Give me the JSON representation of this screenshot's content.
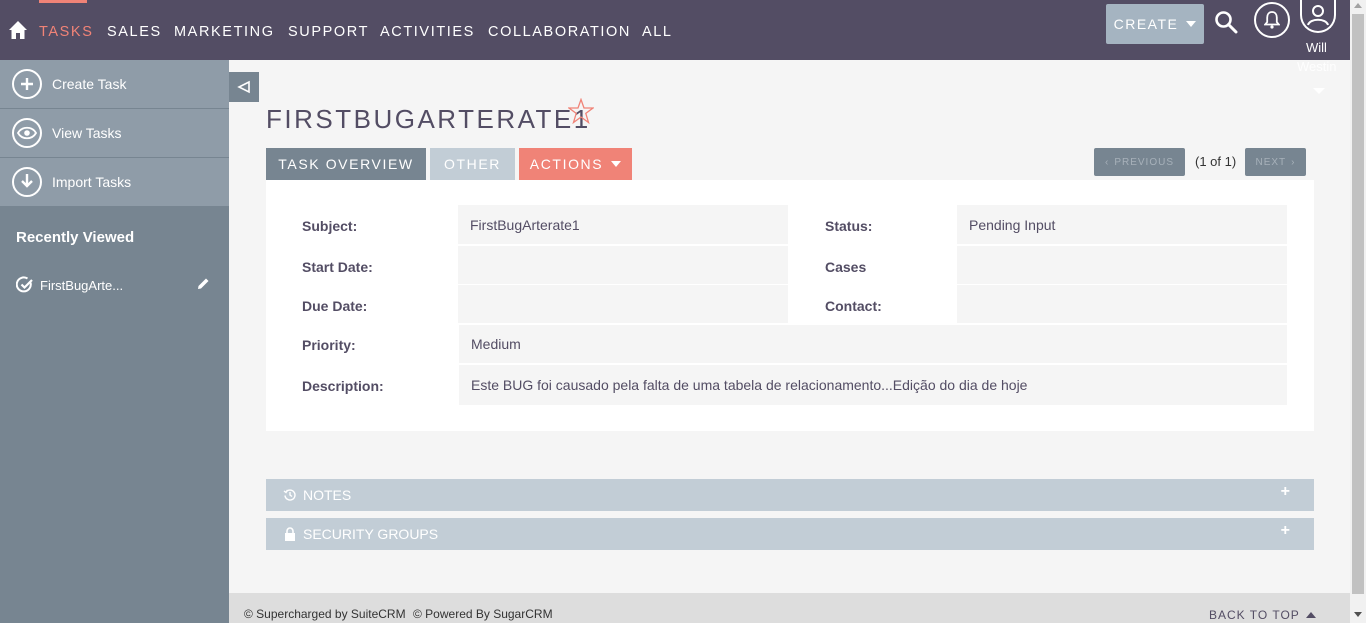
{
  "nav": {
    "items": [
      "TASKS",
      "SALES",
      "MARKETING",
      "SUPPORT",
      "ACTIVITIES",
      "COLLABORATION",
      "ALL"
    ],
    "active": "TASKS",
    "create_label": "CREATE",
    "user_name": "Will",
    "user_name_2": "Westin"
  },
  "sidebar": {
    "actions": [
      {
        "label": "Create Task",
        "icon": "plus-circle-icon"
      },
      {
        "label": "View Tasks",
        "icon": "eye-circle-icon"
      },
      {
        "label": "Import Tasks",
        "icon": "download-circle-icon"
      }
    ],
    "recent_title": "Recently Viewed",
    "recent_items": [
      {
        "label": "FirstBugArte..."
      }
    ]
  },
  "record": {
    "title": "FIRSTBUGARTERATE1",
    "tabs": [
      "TASK OVERVIEW",
      "OTHER",
      "ACTIONS"
    ],
    "pager": {
      "previous": "PREVIOUS",
      "count": "(1 of 1)",
      "next": "NEXT"
    },
    "fields": {
      "subject_label": "Subject:",
      "subject_value": "FirstBugArterate1",
      "status_label": "Status:",
      "status_value": "Pending Input",
      "start_date_label": "Start Date:",
      "start_date_value": "",
      "cases_label": "Cases",
      "cases_value": "",
      "due_date_label": "Due Date:",
      "due_date_value": "",
      "contact_label": "Contact:",
      "contact_value": "",
      "priority_label": "Priority:",
      "priority_value": "Medium",
      "description_label": "Description:",
      "description_value": "Este BUG foi causado pela falta de uma tabela de relacionamento...Edição do dia de hoje"
    }
  },
  "subpanels": [
    {
      "label": "NOTES",
      "icon": "history-icon"
    },
    {
      "label": "SECURITY GROUPS",
      "icon": "lock-icon"
    }
  ],
  "footer": {
    "supercharged": "© Supercharged by SuiteCRM",
    "powered": "© Powered By SugarCRM",
    "back_to_top": "BACK TO TOP"
  },
  "colors": {
    "nav_bg": "#534d64",
    "accent": "#f08377",
    "sidebar_bg": "#778591",
    "sidebar_action_bg": "#8f9ca8",
    "tab_inactive": "#c2cdd6"
  }
}
